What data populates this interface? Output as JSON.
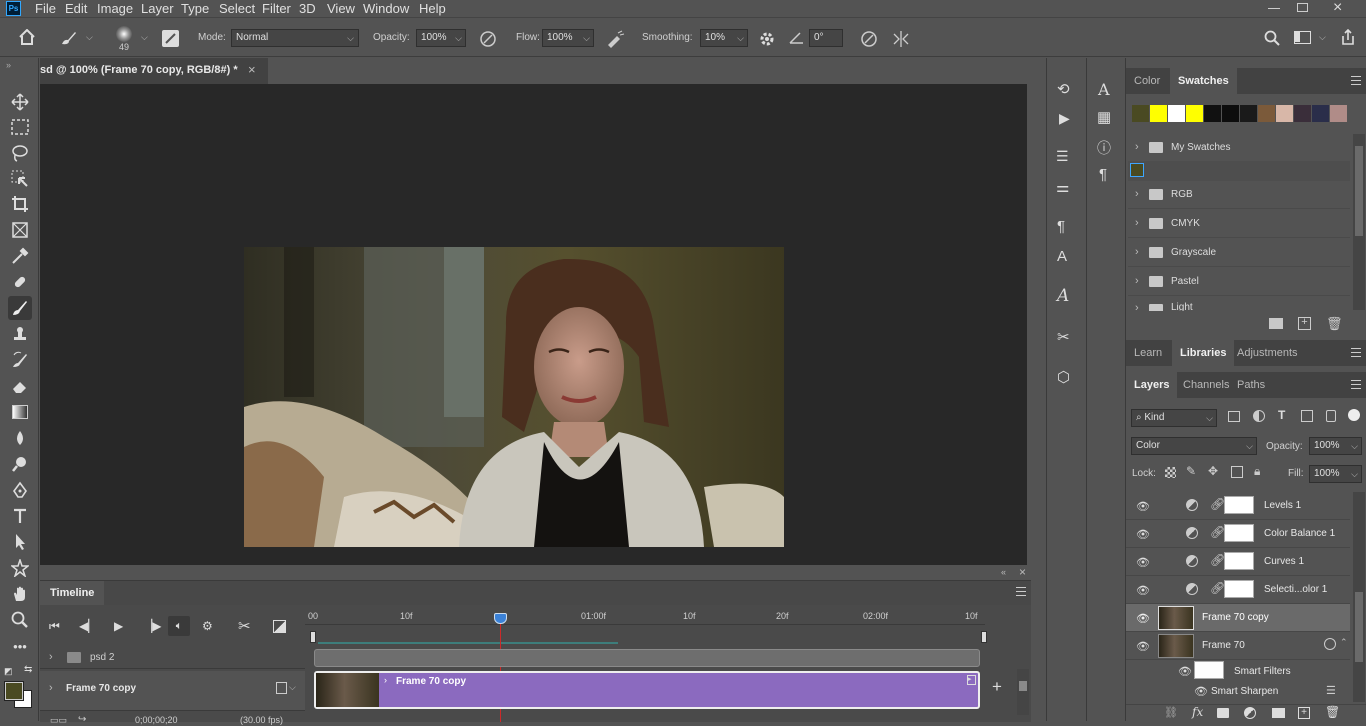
{
  "app": {
    "logo": "Ps"
  },
  "menu": [
    "File",
    "Edit",
    "Image",
    "Layer",
    "Type",
    "Select",
    "Filter",
    "3D",
    "View",
    "Window",
    "Help"
  ],
  "options": {
    "brush_size": "49",
    "mode_label": "Mode:",
    "mode_value": "Normal",
    "opacity_label": "Opacity:",
    "opacity_value": "100%",
    "flow_label": "Flow:",
    "flow_value": "100%",
    "smoothing_label": "Smoothing:",
    "smoothing_value": "10%",
    "angle_value": "0°"
  },
  "document": {
    "tab_title": "sd @ 100% (Frame 70 copy, RGB/8#) *",
    "close": "×"
  },
  "timeline": {
    "title": "Timeline",
    "ruler": [
      "00",
      "10f",
      "01:00f",
      "10f",
      "20f",
      "02:00f",
      "10f"
    ],
    "group_track": "psd 2",
    "layer_track": "Frame 70 copy",
    "clip_label": "Frame 70 copy",
    "timecode": "0;00;00;20",
    "fps": "(30.00 fps)",
    "add": "+"
  },
  "swatches_panel": {
    "tabs": [
      "Color",
      "Swatches"
    ],
    "active_tab": "Swatches",
    "colors": [
      "#4a4a22",
      "#ffff00",
      "#ffffff",
      "#ffff00",
      "#111111",
      "#0d0d0d",
      "#1a1a1a",
      "#7b5a3a",
      "#d8b7a8",
      "#3a2e3a",
      "#2a2e4a",
      "#b08c88"
    ],
    "groups": [
      "My Swatches",
      "RGB",
      "CMYK",
      "Grayscale",
      "Pastel",
      "Light"
    ],
    "selected_color": "#4a4a22"
  },
  "learn_panel": {
    "tabs": [
      "Learn",
      "Libraries",
      "Adjustments"
    ],
    "active_tab": "Libraries"
  },
  "layers_panel": {
    "tabs": [
      "Layers",
      "Channels",
      "Paths"
    ],
    "active_tab": "Layers",
    "filter_label": "Kind",
    "blend_mode": "Color",
    "opacity_label": "Opacity:",
    "opacity_value": "100%",
    "lock_label": "Lock:",
    "fill_label": "Fill:",
    "fill_value": "100%",
    "layers": [
      {
        "name": "Levels 1",
        "type": "adjustment"
      },
      {
        "name": "Color Balance 1",
        "type": "adjustment"
      },
      {
        "name": "Curves 1",
        "type": "adjustment"
      },
      {
        "name": "Selecti...olor 1",
        "type": "adjustment"
      },
      {
        "name": "Frame 70 copy",
        "type": "image",
        "selected": true
      },
      {
        "name": "Frame 70",
        "type": "smart"
      }
    ],
    "smart_filters": "Smart Filters",
    "smart_sharpen": "Smart Sharpen"
  },
  "colors": {
    "fg": "#4a4a22",
    "bg": "#ffffff",
    "clip": "#8b6abf",
    "playhead": "#cc2a2a",
    "accent": "#2f7bd8"
  }
}
